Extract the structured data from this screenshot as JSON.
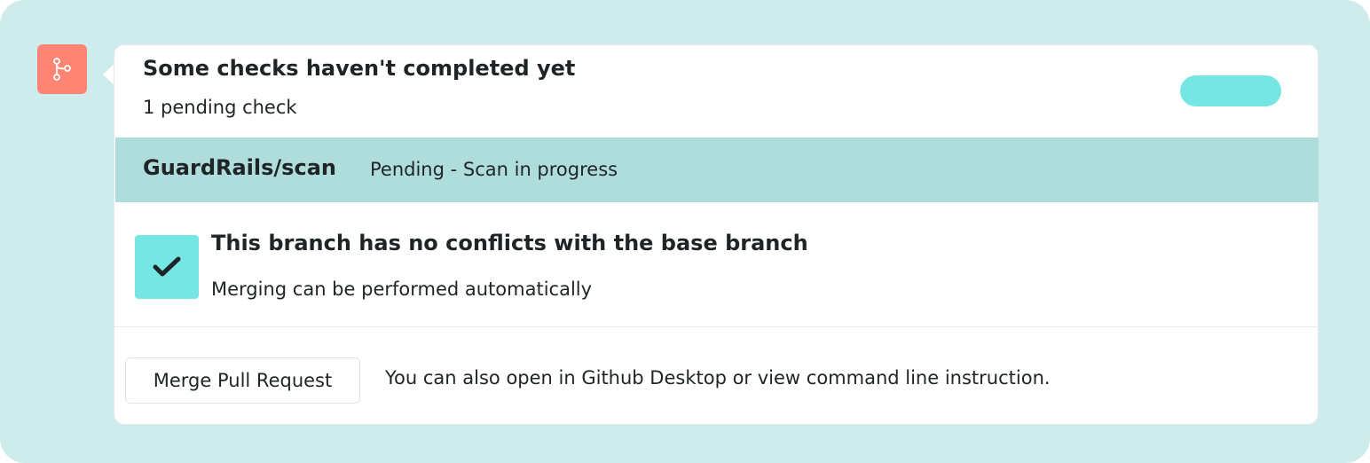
{
  "pull_request": {
    "icon": "git-merge-icon",
    "checks": {
      "title": "Some checks haven't completed yet",
      "subtitle": "1 pending check",
      "items": [
        {
          "name": "GuardRails/scan",
          "status": "Pending - Scan in progress"
        }
      ]
    },
    "branch": {
      "icon": "checkmark-icon",
      "title": "This branch has no conflicts with the base branch",
      "subtitle": "Merging can be performed automatically"
    },
    "footer": {
      "merge_button_label": "Merge Pull Request",
      "hint": "You can also open in Github Desktop or view command line instruction."
    }
  },
  "colors": {
    "background": "#cdeceb",
    "merge_icon_bg": "#ff8473",
    "accent": "#75e6e3",
    "check_row_bg": "#afdddb",
    "text": "#1f2426"
  }
}
